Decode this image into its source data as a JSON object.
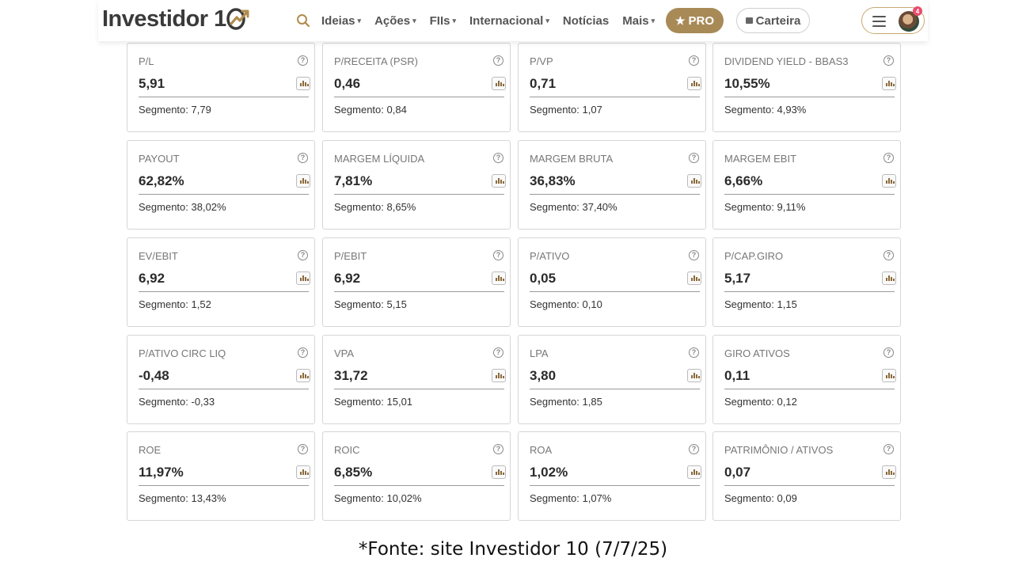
{
  "header": {
    "logo_text": "Investidor 1",
    "nav": [
      {
        "label": "Ideias",
        "caret": true
      },
      {
        "label": "Ações",
        "caret": true
      },
      {
        "label": "FIIs",
        "caret": true
      },
      {
        "label": "Internacional",
        "caret": true
      },
      {
        "label": "Notícias",
        "caret": false
      },
      {
        "label": "Mais",
        "caret": true
      }
    ],
    "pro_label": "PRO",
    "carteira_label": "Carteira",
    "notification_count": "4",
    "icons": [
      "search-icon",
      "star-icon",
      "wallet-icon",
      "hamburger-icon",
      "avatar"
    ],
    "accent_color": "#a88a57"
  },
  "segment_prefix": "Segmento:",
  "cards": [
    {
      "label": "P/L",
      "value": "5,91",
      "segment": "7,79"
    },
    {
      "label": "P/RECEITA (PSR)",
      "value": "0,46",
      "segment": "0,84"
    },
    {
      "label": "P/VP",
      "value": "0,71",
      "segment": "1,07"
    },
    {
      "label": "DIVIDEND YIELD - BBAS3",
      "value": "10,55%",
      "segment": "4,93%"
    },
    {
      "label": "PAYOUT",
      "value": "62,82%",
      "segment": "38,02%"
    },
    {
      "label": "MARGEM LÍQUIDA",
      "value": "7,81%",
      "segment": "8,65%"
    },
    {
      "label": "MARGEM BRUTA",
      "value": "36,83%",
      "segment": "37,40%"
    },
    {
      "label": "MARGEM EBIT",
      "value": "6,66%",
      "segment": "9,11%"
    },
    {
      "label": "EV/EBIT",
      "value": "6,92",
      "segment": "1,52"
    },
    {
      "label": "P/EBIT",
      "value": "6,92",
      "segment": "5,15"
    },
    {
      "label": "P/ATIVO",
      "value": "0,05",
      "segment": "0,10"
    },
    {
      "label": "P/CAP.GIRO",
      "value": "5,17",
      "segment": "1,15"
    },
    {
      "label": "P/ATIVO CIRC LIQ",
      "value": "-0,48",
      "segment": "-0,33"
    },
    {
      "label": "VPA",
      "value": "31,72",
      "segment": "15,01"
    },
    {
      "label": "LPA",
      "value": "3,80",
      "segment": "1,85"
    },
    {
      "label": "GIRO ATIVOS",
      "value": "0,11",
      "segment": "0,12"
    },
    {
      "label": "ROE",
      "value": "11,97%",
      "segment": "13,43%"
    },
    {
      "label": "ROIC",
      "value": "6,85%",
      "segment": "10,02%"
    },
    {
      "label": "ROA",
      "value": "1,02%",
      "segment": "1,07%"
    },
    {
      "label": "PATRIMÔNIO / ATIVOS",
      "value": "0,07",
      "segment": "0,09"
    }
  ],
  "caption": "*Fonte: site Investidor 10 (7/7/25)"
}
